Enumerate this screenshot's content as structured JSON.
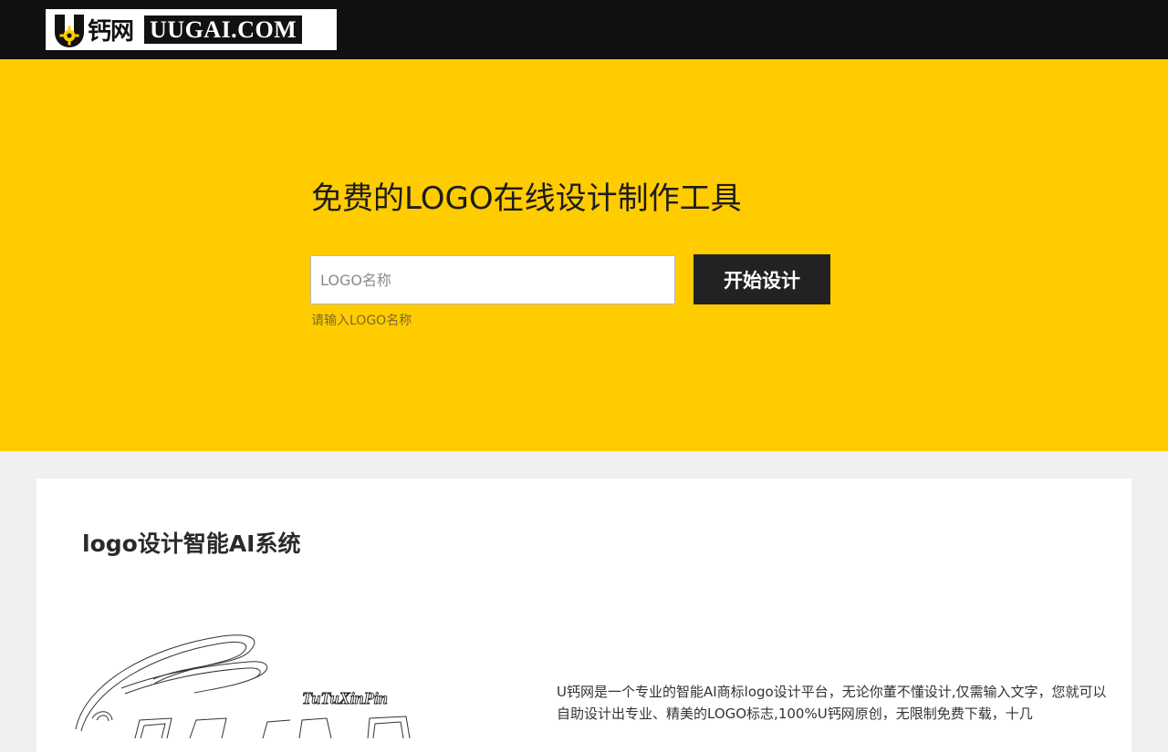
{
  "header": {
    "logo_cn": "钙网",
    "logo_en": "UUGAI.COM",
    "logo_mark_letter": "U"
  },
  "hero": {
    "title": "免费的LOGO在线设计制作工具",
    "input_placeholder": "LOGO名称",
    "input_value": "",
    "button_label": "开始设计",
    "hint": "请输入LOGO名称"
  },
  "section": {
    "title": "logo设计智能AI系统",
    "illustration_label": "TuTuXinPin",
    "description": "U钙网是一个专业的智能AI商标logo设计平台，无论你董不懂设计,仅需输入文字，您就可以自助设计出专业、精美的LOGO标志,100%U钙网原创，无限制免费下载，十几"
  },
  "colors": {
    "topbar": "#101010",
    "hero_background": "#ffcc00",
    "button": "#222222",
    "page_background": "#f0f0f0"
  }
}
